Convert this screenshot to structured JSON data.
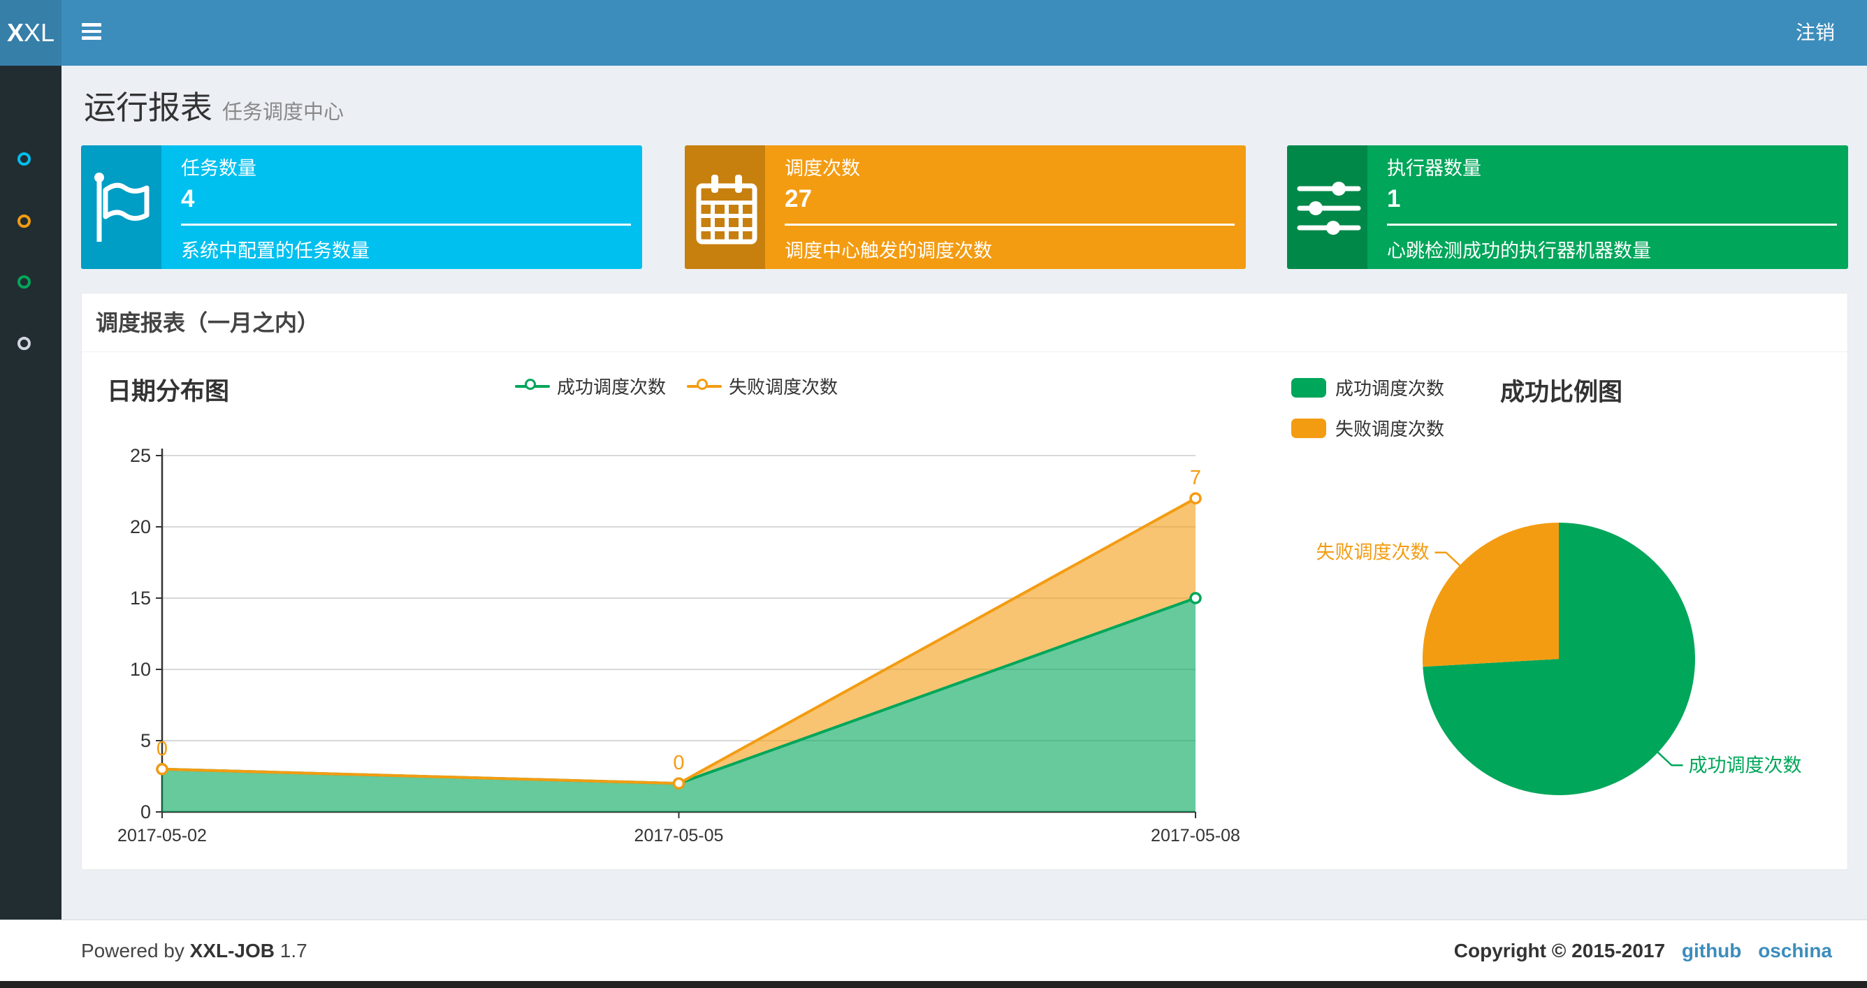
{
  "navbar": {
    "logo_bold": "X",
    "logo_rest": "XL",
    "logout_label": "注销",
    "bg_color": "#3c8dbc",
    "logo_bg_color": "#367fa9"
  },
  "sidebar": {
    "bg_color": "#222d32",
    "items": [
      {
        "name": "circle-aqua",
        "color": "#00c0ef"
      },
      {
        "name": "circle-orange",
        "color": "#f39c12"
      },
      {
        "name": "circle-green",
        "color": "#00a65a"
      },
      {
        "name": "circle-gray",
        "color": "#d2d6de"
      }
    ]
  },
  "header": {
    "title": "运行报表",
    "subtitle": "任务调度中心"
  },
  "info_boxes": [
    {
      "label": "任务数量",
      "value": "4",
      "description": "系统中配置的任务数量",
      "color": "#00c0ef",
      "icon": "flag-icon"
    },
    {
      "label": "调度次数",
      "value": "27",
      "description": "调度中心触发的调度次数",
      "color": "#f39c12",
      "icon": "calendar-icon"
    },
    {
      "label": "执行器数量",
      "value": "1",
      "description": "心跳检测成功的执行器机器数量",
      "color": "#00a65a",
      "icon": "sliders-icon"
    }
  ],
  "panel": {
    "title": "调度报表（一月之内）"
  },
  "chart_data": [
    {
      "type": "area",
      "title": "日期分布图",
      "categories": [
        "2017-05-02",
        "2017-05-05",
        "2017-05-08"
      ],
      "series": [
        {
          "name": "成功调度次数",
          "color": "#00a65a",
          "values": [
            3,
            2,
            15
          ],
          "show_point_labels": false,
          "point_labels": []
        },
        {
          "name": "失败调度次数",
          "color": "#f39c12",
          "values": [
            0,
            0,
            7
          ],
          "show_point_labels": true,
          "point_labels": [
            "0",
            "0",
            "7"
          ]
        }
      ],
      "stacked": true,
      "area_opacity": 0.6,
      "ylim": [
        0,
        25
      ],
      "yticks": [
        0,
        5,
        10,
        15,
        20,
        25
      ],
      "grid": true,
      "legend_position": "top"
    },
    {
      "type": "pie",
      "title": "成功比例图",
      "slices": [
        {
          "name": "成功调度次数",
          "value": 20,
          "color": "#00a65a"
        },
        {
          "name": "失败调度次数",
          "value": 7,
          "color": "#f39c12"
        }
      ],
      "legend_position": "left",
      "start_angle": "top",
      "direction": "clockwise"
    }
  ],
  "footer": {
    "powered_by": "Powered by",
    "product": "XXL-JOB",
    "version": "1.7",
    "copyright": "Copyright © 2015-2017",
    "links": [
      {
        "label": "github"
      },
      {
        "label": "oschina"
      }
    ],
    "link_color": "#3c8dbc"
  }
}
